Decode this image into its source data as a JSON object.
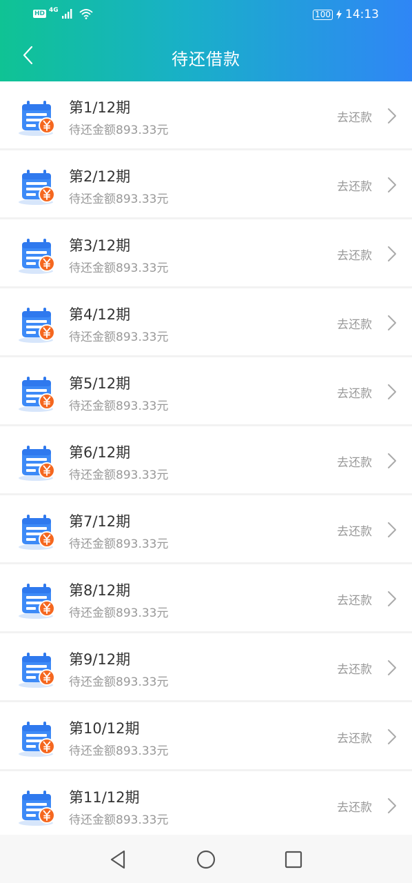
{
  "status_bar": {
    "network": "HD",
    "signal": "4G",
    "battery": "100",
    "time": "14:13"
  },
  "header": {
    "title": "待还借款"
  },
  "items": [
    {
      "title": "第1/12期",
      "subtitle": "待还金额893.33元",
      "action": "去还款"
    },
    {
      "title": "第2/12期",
      "subtitle": "待还金额893.33元",
      "action": "去还款"
    },
    {
      "title": "第3/12期",
      "subtitle": "待还金额893.33元",
      "action": "去还款"
    },
    {
      "title": "第4/12期",
      "subtitle": "待还金额893.33元",
      "action": "去还款"
    },
    {
      "title": "第5/12期",
      "subtitle": "待还金额893.33元",
      "action": "去还款"
    },
    {
      "title": "第6/12期",
      "subtitle": "待还金额893.33元",
      "action": "去还款"
    },
    {
      "title": "第7/12期",
      "subtitle": "待还金额893.33元",
      "action": "去还款"
    },
    {
      "title": "第8/12期",
      "subtitle": "待还金额893.33元",
      "action": "去还款"
    },
    {
      "title": "第9/12期",
      "subtitle": "待还金额893.33元",
      "action": "去还款"
    },
    {
      "title": "第10/12期",
      "subtitle": "待还金额893.33元",
      "action": "去还款"
    },
    {
      "title": "第11/12期",
      "subtitle": "待还金额893.33元",
      "action": "去还款"
    }
  ],
  "icons": {
    "item": "calendar-yuan-icon",
    "chevron": "chevron-right-icon",
    "back": "chevron-left-icon"
  },
  "colors": {
    "header_start": "#0fc394",
    "header_end": "#2f86f6",
    "calendar_blue": "#3d8af7",
    "yuan_orange": "#f5671f"
  }
}
